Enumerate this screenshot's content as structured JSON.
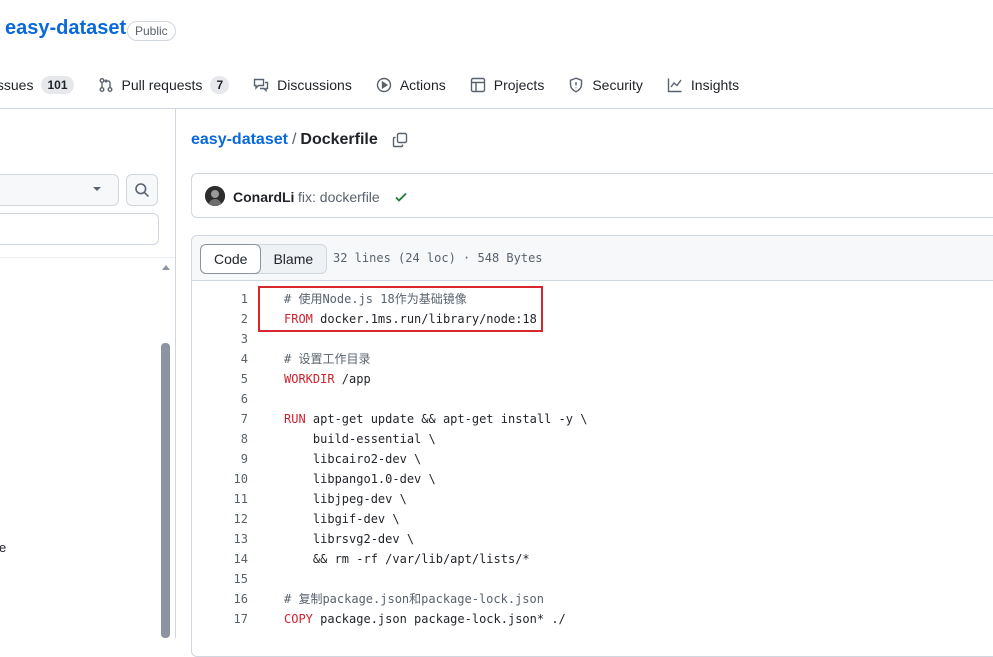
{
  "repo": {
    "name": "easy-dataset",
    "visibility": "Public"
  },
  "nav": [
    {
      "label": "Issues",
      "count": "101",
      "icon": "issue-icon"
    },
    {
      "label": "Pull requests",
      "count": "7",
      "icon": "pull-request-icon"
    },
    {
      "label": "Discussions",
      "count": "",
      "icon": "discussion-icon"
    },
    {
      "label": "Actions",
      "count": "",
      "icon": "actions-play-icon"
    },
    {
      "label": "Projects",
      "count": "",
      "icon": "projects-table-icon"
    },
    {
      "label": "Security",
      "count": "",
      "icon": "shield-icon"
    },
    {
      "label": "Insights",
      "count": "",
      "icon": "graph-icon"
    }
  ],
  "sidebar": {
    "fragment_text": "e"
  },
  "breadcrumb": {
    "repo": "easy-dataset",
    "sep": "/",
    "file": "Dockerfile"
  },
  "commit": {
    "author": "ConardLi",
    "message": "fix: dockerfile"
  },
  "code_view": {
    "tab_code": "Code",
    "tab_blame": "Blame",
    "info": "32 lines (24 loc) · 548 Bytes"
  },
  "lines": [
    {
      "n": "1",
      "kw": "",
      "text": "# 使用Node.js 18作为基础镜像",
      "comment": true
    },
    {
      "n": "2",
      "kw": "FROM",
      "text": " docker.1ms.run/library/node:18",
      "comment": false
    },
    {
      "n": "3",
      "kw": "",
      "text": "",
      "comment": false
    },
    {
      "n": "4",
      "kw": "",
      "text": "# 设置工作目录",
      "comment": true
    },
    {
      "n": "5",
      "kw": "WORKDIR",
      "text": " /app",
      "comment": false
    },
    {
      "n": "6",
      "kw": "",
      "text": "",
      "comment": false
    },
    {
      "n": "7",
      "kw": "RUN",
      "text": " apt-get update && apt-get install -y \\",
      "comment": false
    },
    {
      "n": "8",
      "kw": "",
      "text": "    build-essential \\",
      "comment": false
    },
    {
      "n": "9",
      "kw": "",
      "text": "    libcairo2-dev \\",
      "comment": false
    },
    {
      "n": "10",
      "kw": "",
      "text": "    libpango1.0-dev \\",
      "comment": false
    },
    {
      "n": "11",
      "kw": "",
      "text": "    libjpeg-dev \\",
      "comment": false
    },
    {
      "n": "12",
      "kw": "",
      "text": "    libgif-dev \\",
      "comment": false
    },
    {
      "n": "13",
      "kw": "",
      "text": "    librsvg2-dev \\",
      "comment": false
    },
    {
      "n": "14",
      "kw": "",
      "text": "    && rm -rf /var/lib/apt/lists/*",
      "comment": false
    },
    {
      "n": "15",
      "kw": "",
      "text": "",
      "comment": false
    },
    {
      "n": "16",
      "kw": "",
      "text": "# 复制package.json和package-lock.json",
      "comment": true
    },
    {
      "n": "17",
      "kw": "COPY",
      "text": " package.json package-lock.json* ./",
      "comment": false
    }
  ],
  "colors": {
    "link": "#0969da",
    "keyword": "#cf222e",
    "highlight_border": "#d7262c",
    "success": "#1a7f37"
  }
}
